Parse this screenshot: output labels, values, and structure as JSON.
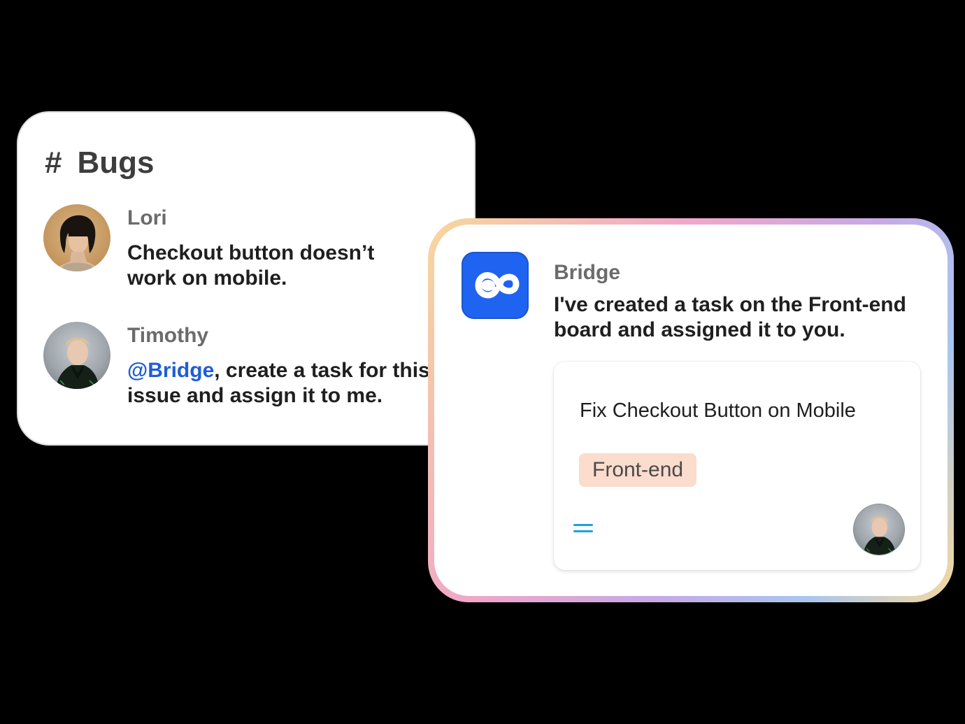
{
  "channel": {
    "name": "Bugs",
    "messages": [
      {
        "author": "Lori",
        "text": "Checkout button doesn’t work on mobile."
      },
      {
        "author": "Timothy",
        "mention": "@Bridge",
        "text": ", create a task for this issue and assign it to me."
      }
    ]
  },
  "bridge": {
    "author": "Bridge",
    "text": "I've created a task on the Front-end board and assigned it to you.",
    "task": {
      "title": "Fix Checkout Button on Mobile",
      "tag": "Front-end",
      "priority_icon": "equals-priority-icon"
    }
  },
  "colors": {
    "background": "#000000",
    "mention": "#1e5dd8",
    "bridge_logo": "#1f64f0",
    "tag_bg": "#fbdccd",
    "priority": "#1ba1e2"
  }
}
